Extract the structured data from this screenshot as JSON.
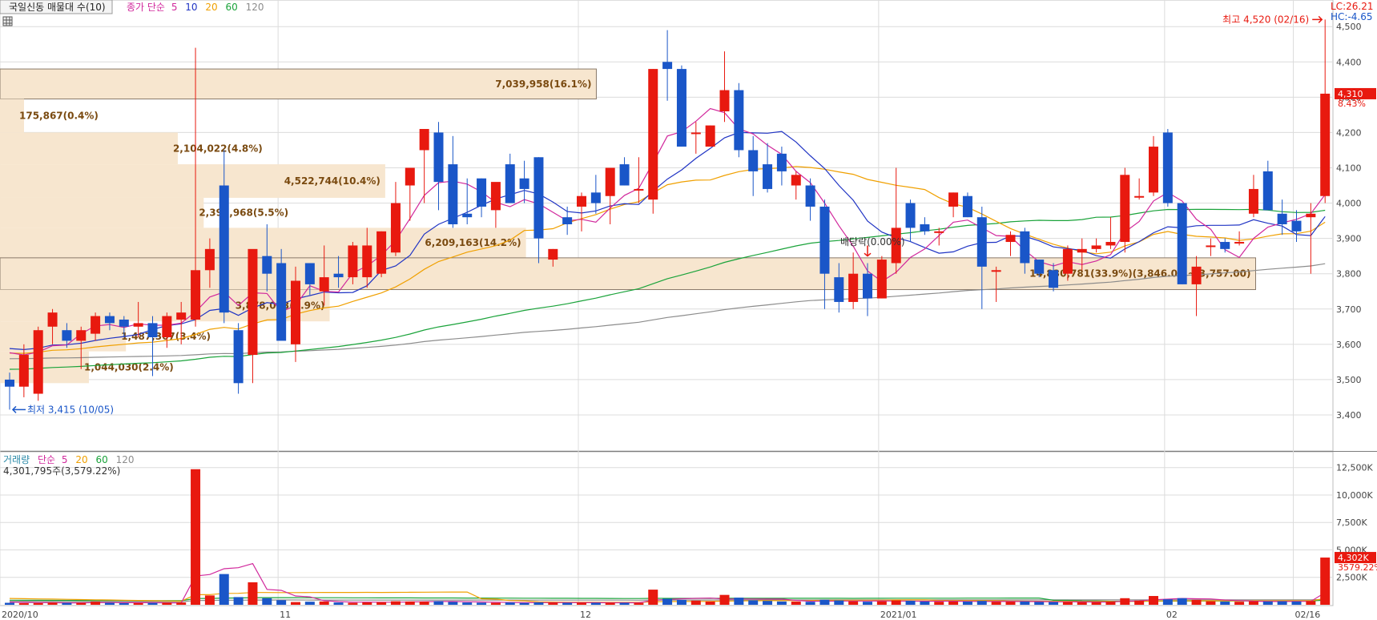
{
  "header": {
    "tab_label": "국일신동 매물대 수(10)",
    "price_legend": {
      "label": "종가 단순",
      "ma": [
        "5",
        "10",
        "20",
        "60",
        "120"
      ]
    },
    "volume_legend": {
      "label": "거래량",
      "sub": "단순",
      "ma": [
        "5",
        "20",
        "60",
        "120"
      ]
    }
  },
  "colors": {
    "up": "#e8190f",
    "down": "#1a56c8",
    "ma5": "#d1289c",
    "ma10": "#2034c4",
    "ma20": "#f0a000",
    "ma60": "#1aa33a",
    "ma120": "#8c8c8c",
    "profile": "#f7e6cf",
    "grid": "#dcdcdc"
  },
  "indicators": {
    "lc": "LC:26.21",
    "hc": "HC:-4.65",
    "high_note": "최고 4,520 (02/16)",
    "low_note": "최저 3,415 (10/05)",
    "dividend_note": "배당락(0.00%)",
    "last_price": "4,310",
    "last_change": "8.43%",
    "volume_summary": "4,301,795주(3,579.22%)",
    "last_volume": "4,302K",
    "last_volume_pct": "3579.22%"
  },
  "chart_data": {
    "type": "candlestick",
    "price_axis": {
      "min": 3350,
      "max": 4530,
      "ticks": [
        "3,400",
        "3,500",
        "3,600",
        "3,700",
        "3,800",
        "3,900",
        "4,000",
        "4,100",
        "4,200",
        "4,300",
        "4,400",
        "4,500"
      ]
    },
    "volume_axis": {
      "max": 13500,
      "ticks": [
        "2,500K",
        "5,000K",
        "7,500K",
        "10,000K",
        "12,500K"
      ]
    },
    "x_labels": [
      {
        "i": 0,
        "label": "2020/10"
      },
      {
        "i": 19,
        "label": "11"
      },
      {
        "i": 40,
        "label": "12"
      },
      {
        "i": 61,
        "label": "2021/01"
      },
      {
        "i": 81,
        "label": "02"
      },
      {
        "i": 90,
        "label": "02/16"
      }
    ],
    "candles": [
      [
        3500,
        3520,
        3415,
        3480,
        180
      ],
      [
        3480,
        3600,
        3450,
        3570,
        150
      ],
      [
        3460,
        3650,
        3440,
        3640,
        160
      ],
      [
        3650,
        3700,
        3600,
        3690,
        200
      ],
      [
        3640,
        3660,
        3590,
        3610,
        170
      ],
      [
        3610,
        3650,
        3530,
        3640,
        180
      ],
      [
        3630,
        3690,
        3610,
        3680,
        280
      ],
      [
        3680,
        3690,
        3640,
        3660,
        180
      ],
      [
        3670,
        3680,
        3620,
        3650,
        150
      ],
      [
        3650,
        3720,
        3620,
        3660,
        160
      ],
      [
        3660,
        3680,
        3510,
        3620,
        170
      ],
      [
        3620,
        3690,
        3590,
        3680,
        200
      ],
      [
        3670,
        3720,
        3600,
        3690,
        210
      ],
      [
        3670,
        4440,
        3650,
        3810,
        12350
      ],
      [
        3810,
        3900,
        3760,
        3870,
        850
      ],
      [
        4050,
        4150,
        3660,
        3690,
        2800
      ],
      [
        3640,
        3660,
        3460,
        3490,
        700
      ],
      [
        3570,
        3860,
        3490,
        3870,
        2050
      ],
      [
        3850,
        3940,
        3750,
        3800,
        600
      ],
      [
        3830,
        3870,
        3620,
        3610,
        420
      ],
      [
        3600,
        3820,
        3550,
        3780,
        250
      ],
      [
        3830,
        3830,
        3740,
        3770,
        280
      ],
      [
        3750,
        3880,
        3710,
        3790,
        300
      ],
      [
        3800,
        3850,
        3760,
        3790,
        210
      ],
      [
        3790,
        3890,
        3770,
        3880,
        180
      ],
      [
        3790,
        3930,
        3760,
        3880,
        220
      ],
      [
        3800,
        3920,
        3790,
        3920,
        240
      ],
      [
        3860,
        4060,
        3850,
        4000,
        320
      ],
      [
        4050,
        4080,
        3950,
        4100,
        300
      ],
      [
        4150,
        4210,
        4000,
        4210,
        290
      ],
      [
        4200,
        4230,
        3980,
        4060,
        330
      ],
      [
        4110,
        4190,
        3930,
        3940,
        260
      ],
      [
        3970,
        4070,
        3940,
        3960,
        210
      ],
      [
        4070,
        4070,
        3960,
        3990,
        190
      ],
      [
        3980,
        4040,
        3930,
        4060,
        180
      ],
      [
        4110,
        4140,
        4000,
        4000,
        210
      ],
      [
        4070,
        4120,
        4000,
        4040,
        170
      ],
      [
        4130,
        4130,
        3830,
        3900,
        220
      ],
      [
        3840,
        3870,
        3820,
        3870,
        190
      ],
      [
        3960,
        3990,
        3910,
        3940,
        180
      ],
      [
        3990,
        4030,
        3920,
        4020,
        190
      ],
      [
        4030,
        4080,
        3970,
        4000,
        180
      ],
      [
        4020,
        4100,
        3940,
        4100,
        180
      ],
      [
        4110,
        4130,
        4050,
        4050,
        180
      ],
      [
        4040,
        4130,
        4000,
        4040,
        170
      ],
      [
        4010,
        4380,
        3970,
        4380,
        1380
      ],
      [
        4400,
        4490,
        4290,
        4380,
        550
      ],
      [
        4380,
        4390,
        4160,
        4160,
        450
      ],
      [
        4200,
        4230,
        4140,
        4200,
        380
      ],
      [
        4160,
        4220,
        4180,
        4220,
        300
      ],
      [
        4260,
        4430,
        4230,
        4320,
        900
      ],
      [
        4320,
        4340,
        4130,
        4150,
        650
      ],
      [
        4150,
        4190,
        4020,
        4090,
        400
      ],
      [
        4110,
        4170,
        4030,
        4040,
        350
      ],
      [
        4140,
        4160,
        4050,
        4090,
        300
      ],
      [
        4050,
        4090,
        4010,
        4080,
        290
      ],
      [
        4050,
        4070,
        3950,
        3990,
        270
      ],
      [
        3990,
        4010,
        3700,
        3800,
        450
      ],
      [
        3790,
        3830,
        3690,
        3720,
        400
      ],
      [
        3720,
        3860,
        3700,
        3800,
        320
      ],
      [
        3800,
        3830,
        3680,
        3730,
        280
      ],
      [
        3730,
        3850,
        3730,
        3840,
        320
      ],
      [
        3830,
        4100,
        3800,
        3930,
        400
      ],
      [
        4000,
        4010,
        3890,
        3930,
        360
      ],
      [
        3940,
        3960,
        3910,
        3920,
        300
      ],
      [
        3920,
        3930,
        3880,
        3920,
        280
      ],
      [
        3990,
        4030,
        3960,
        4030,
        300
      ],
      [
        4020,
        4030,
        3960,
        3960,
        290
      ],
      [
        3960,
        3990,
        3700,
        3820,
        350
      ],
      [
        3810,
        3820,
        3720,
        3810,
        270
      ],
      [
        3890,
        3920,
        3850,
        3910,
        280
      ],
      [
        3920,
        3930,
        3800,
        3830,
        300
      ],
      [
        3840,
        3840,
        3790,
        3800,
        260
      ],
      [
        3810,
        3830,
        3750,
        3760,
        250
      ],
      [
        3800,
        3880,
        3780,
        3870,
        260
      ],
      [
        3860,
        3900,
        3810,
        3870,
        240
      ],
      [
        3870,
        3900,
        3860,
        3880,
        240
      ],
      [
        3880,
        3960,
        3870,
        3890,
        280
      ],
      [
        3890,
        4100,
        3860,
        4080,
        600
      ],
      [
        4020,
        4070,
        4010,
        4020,
        380
      ],
      [
        4030,
        4190,
        4020,
        4160,
        800
      ],
      [
        4200,
        4210,
        3990,
        4000,
        500
      ],
      [
        4000,
        4000,
        3770,
        3770,
        600
      ],
      [
        3770,
        3850,
        3680,
        3820,
        450
      ],
      [
        3880,
        3900,
        3850,
        3880,
        320
      ],
      [
        3890,
        3900,
        3860,
        3870,
        290
      ],
      [
        3890,
        3920,
        3880,
        3890,
        280
      ],
      [
        3970,
        4080,
        3960,
        4040,
        320
      ],
      [
        4090,
        4120,
        3990,
        3980,
        300
      ],
      [
        3970,
        4010,
        3910,
        3940,
        320
      ],
      [
        3950,
        3980,
        3890,
        3920,
        300
      ],
      [
        3960,
        4000,
        3800,
        3970,
        340
      ],
      [
        4020,
        4520,
        4000,
        4310,
        4302
      ]
    ],
    "volume_profile": [
      {
        "low": 4295,
        "high": 4380,
        "label": "7,039,958(16.1%)"
      },
      {
        "low": 4200,
        "high": 4295,
        "label": "175,867(0.4%)"
      },
      {
        "low": 4110,
        "high": 4200,
        "label": "2,104,022(4.8%)"
      },
      {
        "low": 4015,
        "high": 4110,
        "label": "4,522,744(10.4%)"
      },
      {
        "low": 3930,
        "high": 4015,
        "label": "2,393,968(5.5%)"
      },
      {
        "low": 3845,
        "high": 3930,
        "label": "6,209,163(14.2%)"
      },
      {
        "low": 3755,
        "high": 3845,
        "label": "14,830,781(33.9%)(3,846.00 ~ 3,757.00)"
      },
      {
        "low": 3665,
        "high": 3755,
        "label": "3,878,013(8.9%)"
      },
      {
        "low": 3580,
        "high": 3665,
        "label": "1,487,367(3.4%)"
      },
      {
        "low": 3490,
        "high": 3580,
        "label": "1,044,030(2.4%)"
      }
    ]
  }
}
